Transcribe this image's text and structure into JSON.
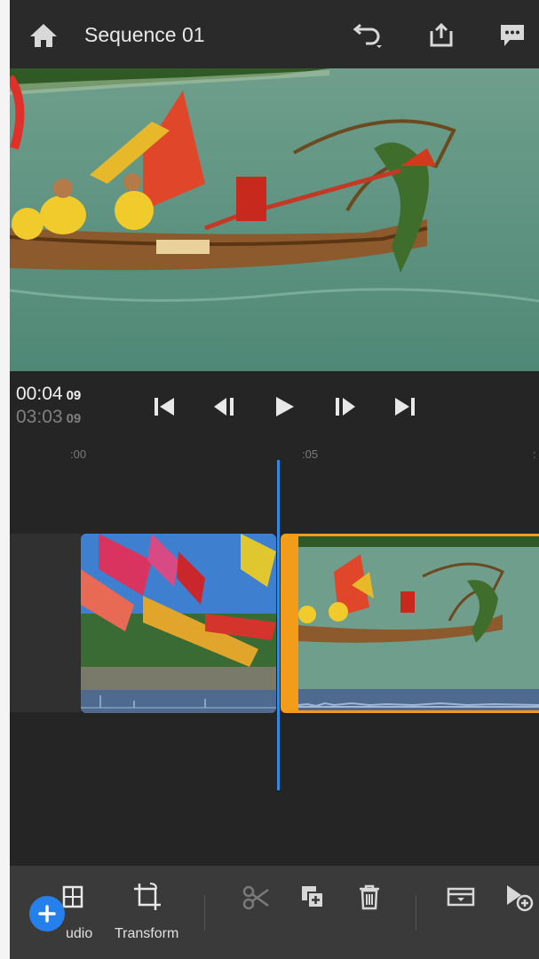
{
  "header": {
    "title": "Sequence 01",
    "icons": [
      "home-icon",
      "undo-icon",
      "share-icon",
      "feedback-icon"
    ]
  },
  "timecode": {
    "current": "00:04",
    "current_frames": "09",
    "total": "03:03",
    "total_frames": "09"
  },
  "transport": [
    "skip-to-start-icon",
    "step-back-icon",
    "play-icon",
    "step-forward-icon",
    "skip-to-end-icon"
  ],
  "ruler": {
    "labels": [
      ":00",
      ":05",
      ":"
    ]
  },
  "timeline": {
    "clips": [
      {
        "name": "flags-harbor-clip",
        "selected": false
      },
      {
        "name": "dragon-boat-clip",
        "selected": true
      }
    ],
    "playhead_color": "#2d8ae8",
    "selection_color": "#f39c19"
  },
  "toolbar": {
    "audio_label": "udio",
    "transform_label": "Transform",
    "icons": [
      "scissors-icon",
      "duplicate-icon",
      "trash-icon",
      "tray-icon",
      "add-select-icon"
    ]
  },
  "accent": "#2680eb"
}
